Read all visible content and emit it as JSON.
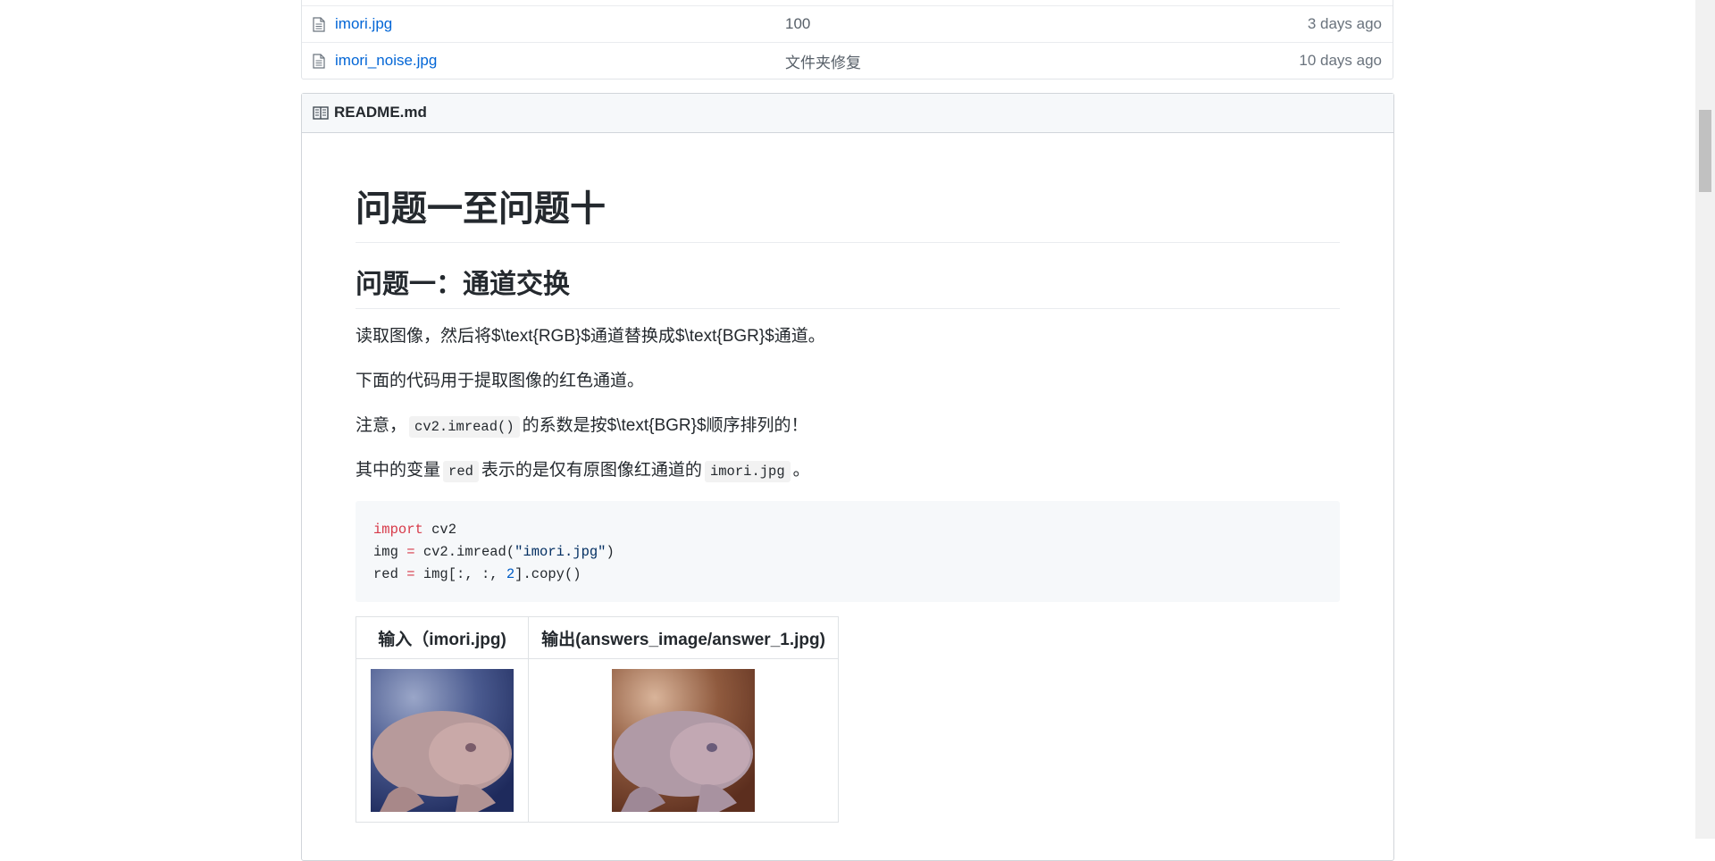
{
  "file_list": [
    {
      "name": "imori.jpg",
      "message": "100",
      "age": "3 days ago"
    },
    {
      "name": "imori_noise.jpg",
      "message": "文件夹修复",
      "age": "10 days ago"
    }
  ],
  "readme": {
    "filename": "README.md",
    "h1": "问题一至问题十",
    "h2": "问题一：通道交换",
    "p1": "读取图像，然后将$\\text{RGB}$通道替换成$\\text{BGR}$通道。",
    "p2": "下面的代码用于提取图像的红色通道。",
    "p3_before": "注意，",
    "p3_code": "cv2.imread()",
    "p3_after": "的系数是按$\\text{BGR}$顺序排列的！",
    "p4_before": "其中的变量",
    "p4_code1": "red",
    "p4_mid": "表示的是仅有原图像红通道的",
    "p4_code2": "imori.jpg",
    "p4_after": "。",
    "code": {
      "l1_kw": "import",
      "l1_rest": " cv2",
      "l2_a": "img ",
      "l2_op": "=",
      "l2_b": " cv2.imread(",
      "l2_str": "\"imori.jpg\"",
      "l2_c": ")",
      "l3_a": "red ",
      "l3_op": "=",
      "l3_b": " img[:, :, ",
      "l3_num": "2",
      "l3_c": "].copy()"
    },
    "table": {
      "headers": [
        "输入（imori.jpg)",
        "输出(answers_image/answer_1.jpg)"
      ]
    }
  },
  "icons": {
    "file": "file-icon",
    "book": "book-icon"
  },
  "colors": {
    "link": "#0366d6",
    "keyword": "#d73a49",
    "string": "#032f62",
    "number": "#005cc5"
  }
}
